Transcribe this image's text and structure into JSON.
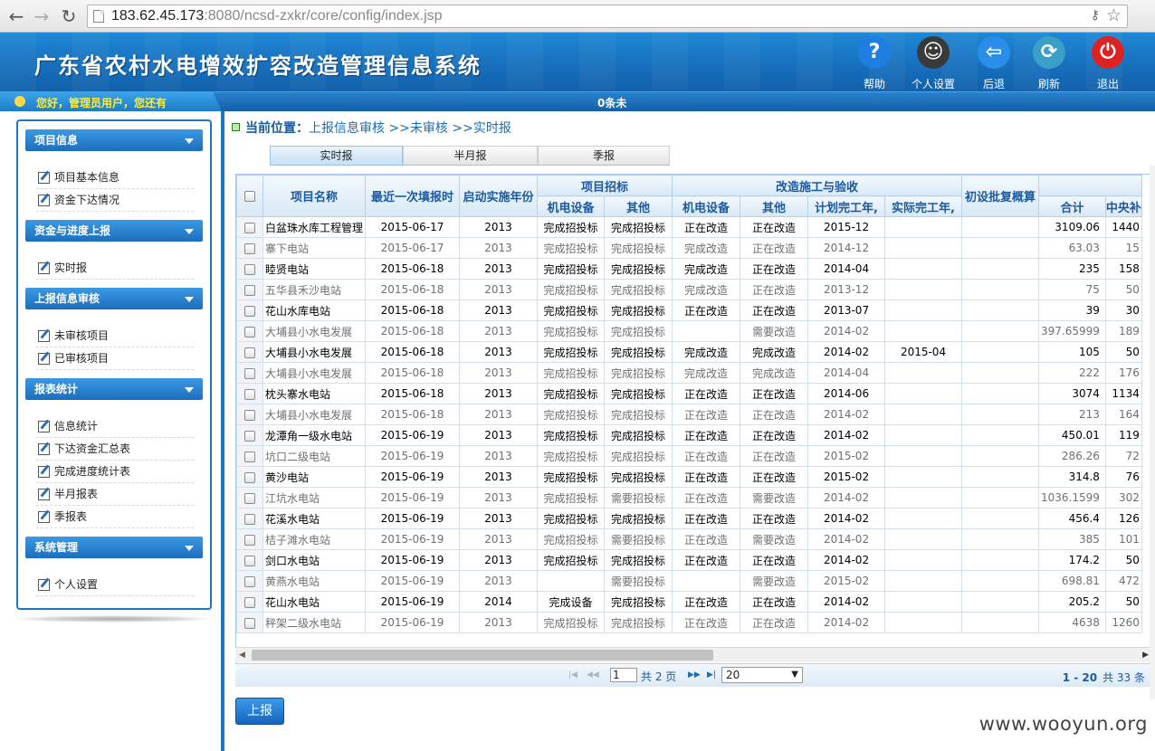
{
  "browser": {
    "url_host": "183.62.45.173",
    "url_rest": ":8080/ncsd-zxkr/core/config/index.jsp"
  },
  "header": {
    "title": "广东省农村水电增效扩容改造管理信息系统",
    "buttons": [
      {
        "label": "帮助",
        "icon": "question-icon",
        "color": "#1e7fe0"
      },
      {
        "label": "个人设置",
        "icon": "user-icon",
        "color": "#3a3a3a"
      },
      {
        "label": "后退",
        "icon": "back-arrow-icon",
        "color": "#2a8ee8"
      },
      {
        "label": "刷新",
        "icon": "refresh-globe-icon",
        "color": "#3aa0c8"
      },
      {
        "label": "退出",
        "icon": "power-icon",
        "color": "#d22"
      }
    ]
  },
  "infobar": {
    "greeting": "您好，管理员用户，您还有",
    "center": "0条未"
  },
  "sidebar": {
    "sections": [
      {
        "title": "项目信息",
        "items": [
          "项目基本信息",
          "资金下达情况"
        ]
      },
      {
        "title": "资金与进度上报",
        "items": [
          "实时报"
        ]
      },
      {
        "title": "上报信息审核",
        "items": [
          "未审核项目",
          "已审核项目"
        ]
      },
      {
        "title": "报表统计",
        "items": [
          "信息统计",
          "下达资金汇总表",
          "完成进度统计表",
          "半月报表",
          "季报表"
        ]
      },
      {
        "title": "系统管理",
        "items": [
          "个人设置"
        ]
      }
    ]
  },
  "breadcrumb": {
    "label": "当前位置：",
    "path": "上报信息审核 >>未审核 >>实时报"
  },
  "tabs": [
    "实时报",
    "半月报",
    "季报"
  ],
  "grid": {
    "group_headers": {
      "bidding": "项目招标",
      "construction": "改造施工与验收"
    },
    "columns": {
      "name": "项目名称",
      "last_report": "最近一次填报时",
      "start_year": "启动实施年份",
      "bid_mech": "机电设备",
      "bid_other": "其他",
      "con_mech": "机电设备",
      "con_other": "其他",
      "planned": "计划完工年,",
      "actual": "实际完工年,",
      "approval": "初设批复概算",
      "total": "合计",
      "central": "中央补"
    },
    "rows": [
      {
        "s": "b",
        "name": "白盆珠水库工程管理",
        "date": "2015-06-17",
        "year": "2013",
        "bm": "完成招投标",
        "bo": "完成招投标",
        "cm": "正在改造",
        "co": "正在改造",
        "plan": "2015-12",
        "act": "",
        "appr": "",
        "total": "3109.06",
        "central": "1440"
      },
      {
        "s": "g",
        "name": "寨下电站",
        "date": "2015-06-17",
        "year": "2013",
        "bm": "完成招投标",
        "bo": "完成招投标",
        "cm": "完成改造",
        "co": "正在改造",
        "plan": "2014-12",
        "act": "",
        "appr": "",
        "total": "63.03",
        "central": "15"
      },
      {
        "s": "b",
        "name": "睦贤电站",
        "date": "2015-06-18",
        "year": "2013",
        "bm": "完成招投标",
        "bo": "完成招投标",
        "cm": "完成改造",
        "co": "正在改造",
        "plan": "2014-04",
        "act": "",
        "appr": "",
        "total": "235",
        "central": "158"
      },
      {
        "s": "g",
        "name": "五华县禾沙电站",
        "date": "2015-06-18",
        "year": "2013",
        "bm": "完成招投标",
        "bo": "完成招投标",
        "cm": "完成改造",
        "co": "正在改造",
        "plan": "2013-12",
        "act": "",
        "appr": "",
        "total": "75",
        "central": "50"
      },
      {
        "s": "b",
        "name": "花山水库电站",
        "date": "2015-06-18",
        "year": "2013",
        "bm": "完成招投标",
        "bo": "完成招投标",
        "cm": "正在改造",
        "co": "正在改造",
        "plan": "2013-07",
        "act": "",
        "appr": "",
        "total": "39",
        "central": "30"
      },
      {
        "s": "g",
        "name": "大埔县小水电发展",
        "date": "2015-06-18",
        "year": "2013",
        "bm": "完成招投标",
        "bo": "完成招投标",
        "cm": "",
        "co": "需要改造",
        "plan": "2014-02",
        "act": "",
        "appr": "",
        "total": "397.65999",
        "central": "189"
      },
      {
        "s": "b",
        "name": "大埔县小水电发展",
        "date": "2015-06-18",
        "year": "2013",
        "bm": "完成招投标",
        "bo": "完成招投标",
        "cm": "完成改造",
        "co": "完成改造",
        "plan": "2014-02",
        "act": "2015-04",
        "appr": "",
        "total": "105",
        "central": "50"
      },
      {
        "s": "g",
        "name": "大埔县小水电发展",
        "date": "2015-06-18",
        "year": "2013",
        "bm": "完成招投标",
        "bo": "完成招投标",
        "cm": "完成改造",
        "co": "完成改造",
        "plan": "2014-04",
        "act": "",
        "appr": "",
        "total": "222",
        "central": "176"
      },
      {
        "s": "b",
        "name": "枕头寨水电站",
        "date": "2015-06-18",
        "year": "2013",
        "bm": "完成招投标",
        "bo": "完成招投标",
        "cm": "正在改造",
        "co": "正在改造",
        "plan": "2014-06",
        "act": "",
        "appr": "",
        "total": "3074",
        "central": "1134"
      },
      {
        "s": "g",
        "name": "大埔县小水电发展",
        "date": "2015-06-18",
        "year": "2013",
        "bm": "完成招投标",
        "bo": "完成招投标",
        "cm": "正在改造",
        "co": "正在改造",
        "plan": "2014-02",
        "act": "",
        "appr": "",
        "total": "213",
        "central": "164"
      },
      {
        "s": "b",
        "name": "龙潭角一级水电站",
        "date": "2015-06-19",
        "year": "2013",
        "bm": "完成招投标",
        "bo": "完成招投标",
        "cm": "正在改造",
        "co": "正在改造",
        "plan": "2014-02",
        "act": "",
        "appr": "",
        "total": "450.01",
        "central": "119"
      },
      {
        "s": "g",
        "name": "坑口二级电站",
        "date": "2015-06-19",
        "year": "2013",
        "bm": "完成招投标",
        "bo": "完成招投标",
        "cm": "正在改造",
        "co": "正在改造",
        "plan": "2015-02",
        "act": "",
        "appr": "",
        "total": "286.26",
        "central": "72"
      },
      {
        "s": "b",
        "name": "黄沙电站",
        "date": "2015-06-19",
        "year": "2013",
        "bm": "完成招投标",
        "bo": "完成招投标",
        "cm": "正在改造",
        "co": "正在改造",
        "plan": "2015-02",
        "act": "",
        "appr": "",
        "total": "314.8",
        "central": "76"
      },
      {
        "s": "g",
        "name": "江坑水电站",
        "date": "2015-06-19",
        "year": "2013",
        "bm": "完成招投标",
        "bo": "需要招投标",
        "cm": "正在改造",
        "co": "需要改造",
        "plan": "2014-02",
        "act": "",
        "appr": "",
        "total": "1036.1599",
        "central": "302"
      },
      {
        "s": "b",
        "name": "花溪水电站",
        "date": "2015-06-19",
        "year": "2013",
        "bm": "完成招投标",
        "bo": "完成招投标",
        "cm": "正在改造",
        "co": "正在改造",
        "plan": "2014-02",
        "act": "",
        "appr": "",
        "total": "456.4",
        "central": "126"
      },
      {
        "s": "g",
        "name": "桔子滩水电站",
        "date": "2015-06-19",
        "year": "2013",
        "bm": "完成招投标",
        "bo": "需要招投标",
        "cm": "正在改造",
        "co": "需要改造",
        "plan": "2014-02",
        "act": "",
        "appr": "",
        "total": "385",
        "central": "101"
      },
      {
        "s": "b",
        "name": "剑口水电站",
        "date": "2015-06-19",
        "year": "2013",
        "bm": "完成招投标",
        "bo": "完成招投标",
        "cm": "正在改造",
        "co": "正在改造",
        "plan": "2014-02",
        "act": "",
        "appr": "",
        "total": "174.2",
        "central": "50"
      },
      {
        "s": "g",
        "name": "黄燕水电站",
        "date": "2015-06-19",
        "year": "2013",
        "bm": "",
        "bo": "需要招投标",
        "cm": "",
        "co": "需要改造",
        "plan": "2015-02",
        "act": "",
        "appr": "",
        "total": "698.81",
        "central": "472"
      },
      {
        "s": "b",
        "name": "花山水电站",
        "date": "2015-06-19",
        "year": "2014",
        "bm": "完成设备",
        "bo": "完成招投标",
        "cm": "正在改造",
        "co": "正在改造",
        "plan": "2014-02",
        "act": "",
        "appr": "",
        "total": "205.2",
        "central": "50"
      },
      {
        "s": "g",
        "name": "秤架二级水电站",
        "date": "2015-06-19",
        "year": "2013",
        "bm": "完成招投标",
        "bo": "完成招投标",
        "cm": "正在改造",
        "co": "正在改造",
        "plan": "2014-02",
        "act": "",
        "appr": "",
        "total": "4638",
        "central": "1260"
      }
    ]
  },
  "pager": {
    "page": "1",
    "total_pages": "共 2 页",
    "page_size": "20",
    "range": "1 - 20",
    "count": "共 33 条"
  },
  "submit_label": "上报",
  "watermark": "www.wooyun.org"
}
